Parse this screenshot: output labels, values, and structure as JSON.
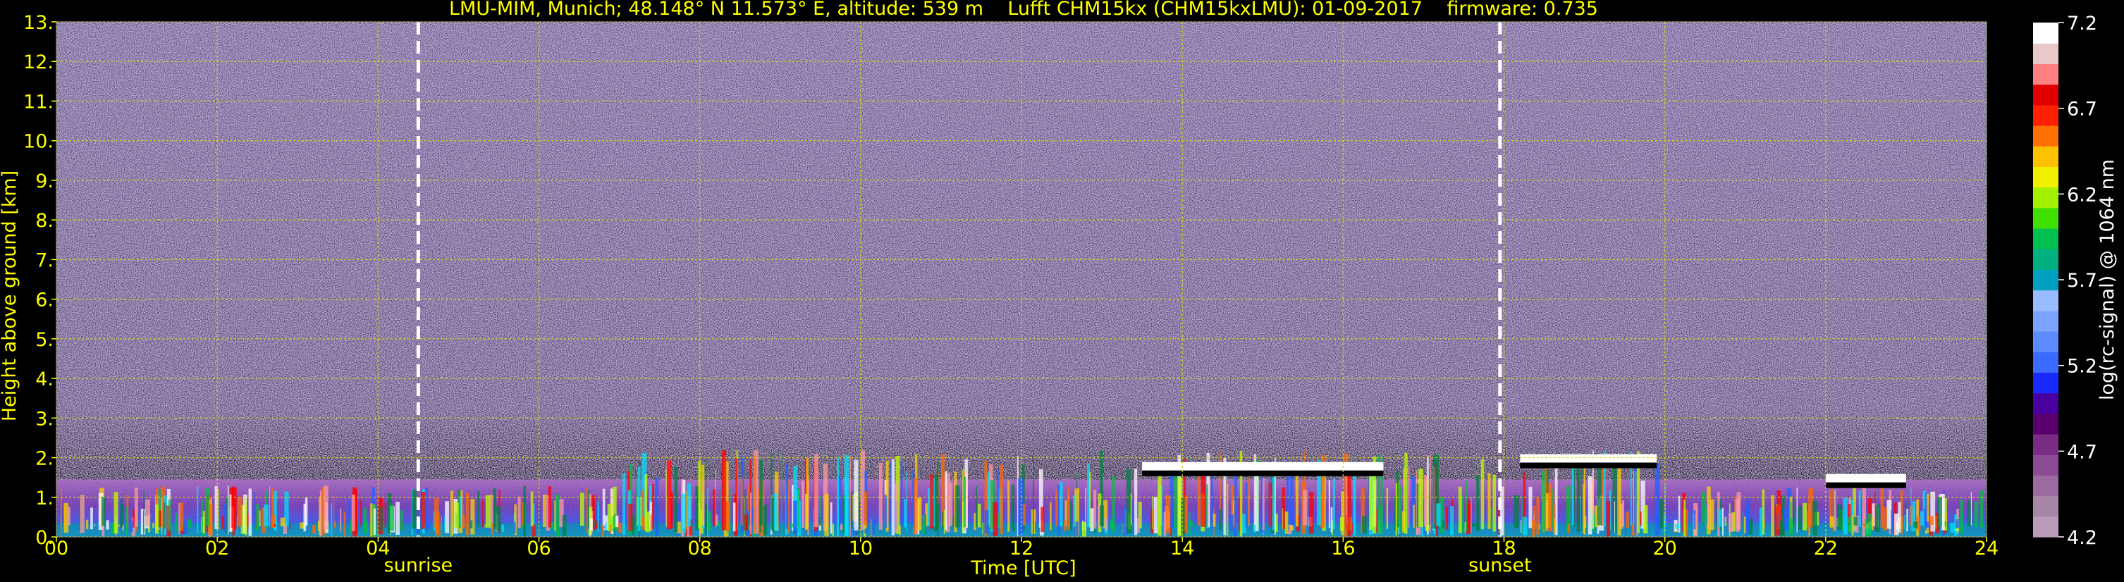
{
  "chart_data": {
    "type": "heatmap",
    "title": "LMU-MIM, Munich; 48.148° N 11.573° E, altitude: 539 m    Lufft CHM15kx (CHM15kxLMU): 01-09-2017    firmware: 0.735",
    "xlabel": "Time [UTC]",
    "ylabel": "Height above ground [km]",
    "xlim": [
      0,
      24
    ],
    "ylim": [
      0,
      13
    ],
    "x_ticks": [
      "00",
      "02",
      "04",
      "06",
      "08",
      "10",
      "12",
      "14",
      "16",
      "18",
      "20",
      "22",
      "24"
    ],
    "y_ticks": [
      "0.",
      "1.",
      "2.",
      "3.",
      "4.",
      "5.",
      "6.",
      "7.",
      "8.",
      "9.",
      "10.",
      "11.",
      "12.",
      "13."
    ],
    "grid": true,
    "colorbar": {
      "label": "log(rc-signal) @ 1064 nm",
      "range": [
        4.2,
        7.2
      ],
      "ticks": [
        "4.2",
        "4.7",
        "5.2",
        "5.7",
        "6.2",
        "6.7",
        "7.2"
      ]
    },
    "markers": [
      {
        "label": "sunrise",
        "time": 4.5
      },
      {
        "label": "sunset",
        "time": 17.95
      }
    ],
    "features": {
      "noise_background": "purple speckle above ~2 km",
      "boundary_layer_top_km": [
        1.0,
        1.5,
        2.0
      ],
      "cloud_layers": [
        {
          "from": 13.5,
          "to": 16.5,
          "height_km": 1.8
        },
        {
          "from": 18.2,
          "to": 19.9,
          "height_km": 2.0
        },
        {
          "from": 22.0,
          "to": 23.0,
          "height_km": 1.5
        }
      ]
    }
  }
}
